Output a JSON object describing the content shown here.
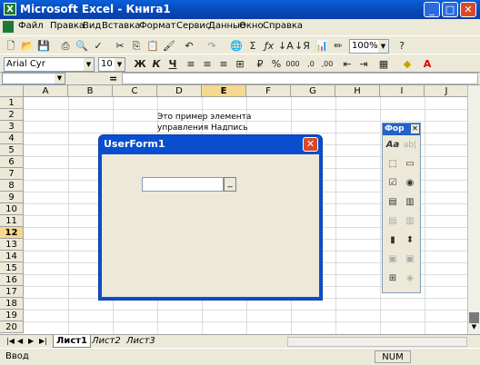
{
  "window": {
    "title": "Microsoft Excel - Книга1"
  },
  "menu": [
    "Файл",
    "Правка",
    "Вид",
    "Вставка",
    "Формат",
    "Сервис",
    "Данные",
    "Окно",
    "Справка"
  ],
  "toolbar": {
    "zoom": "100%"
  },
  "format": {
    "font": "Arial Cyr",
    "size": "10",
    "bold": "Ж",
    "italic": "К",
    "underline": "Ч",
    "thousands": "000"
  },
  "formula": {
    "name_box": "",
    "fx": "="
  },
  "columns": [
    "A",
    "B",
    "C",
    "D",
    "E",
    "F",
    "G",
    "H",
    "I",
    "J"
  ],
  "selected_column": "E",
  "rows": [
    "1",
    "2",
    "3",
    "4",
    "5",
    "6",
    "7",
    "8",
    "9",
    "10",
    "11",
    "12",
    "13",
    "14",
    "15",
    "16",
    "17",
    "18",
    "19",
    "20"
  ],
  "selected_row": "12",
  "cells": {
    "label_line1": "Это пример элемента",
    "label_line2": "управления Надпись"
  },
  "userform": {
    "title": "UserForm1",
    "button_label": "_"
  },
  "forms_toolbar": {
    "title": "Фор",
    "label_icon": "Aa",
    "textbox_icon": "ab|"
  },
  "sheets": [
    "Лист1",
    "Лист2",
    "Лист3"
  ],
  "active_sheet": "Лист1",
  "status": {
    "mode": "Ввод",
    "num": "NUM"
  },
  "colors": {
    "title_blue": "#0a4ed0",
    "close_red": "#d94a2a",
    "chrome": "#ece9d8"
  }
}
